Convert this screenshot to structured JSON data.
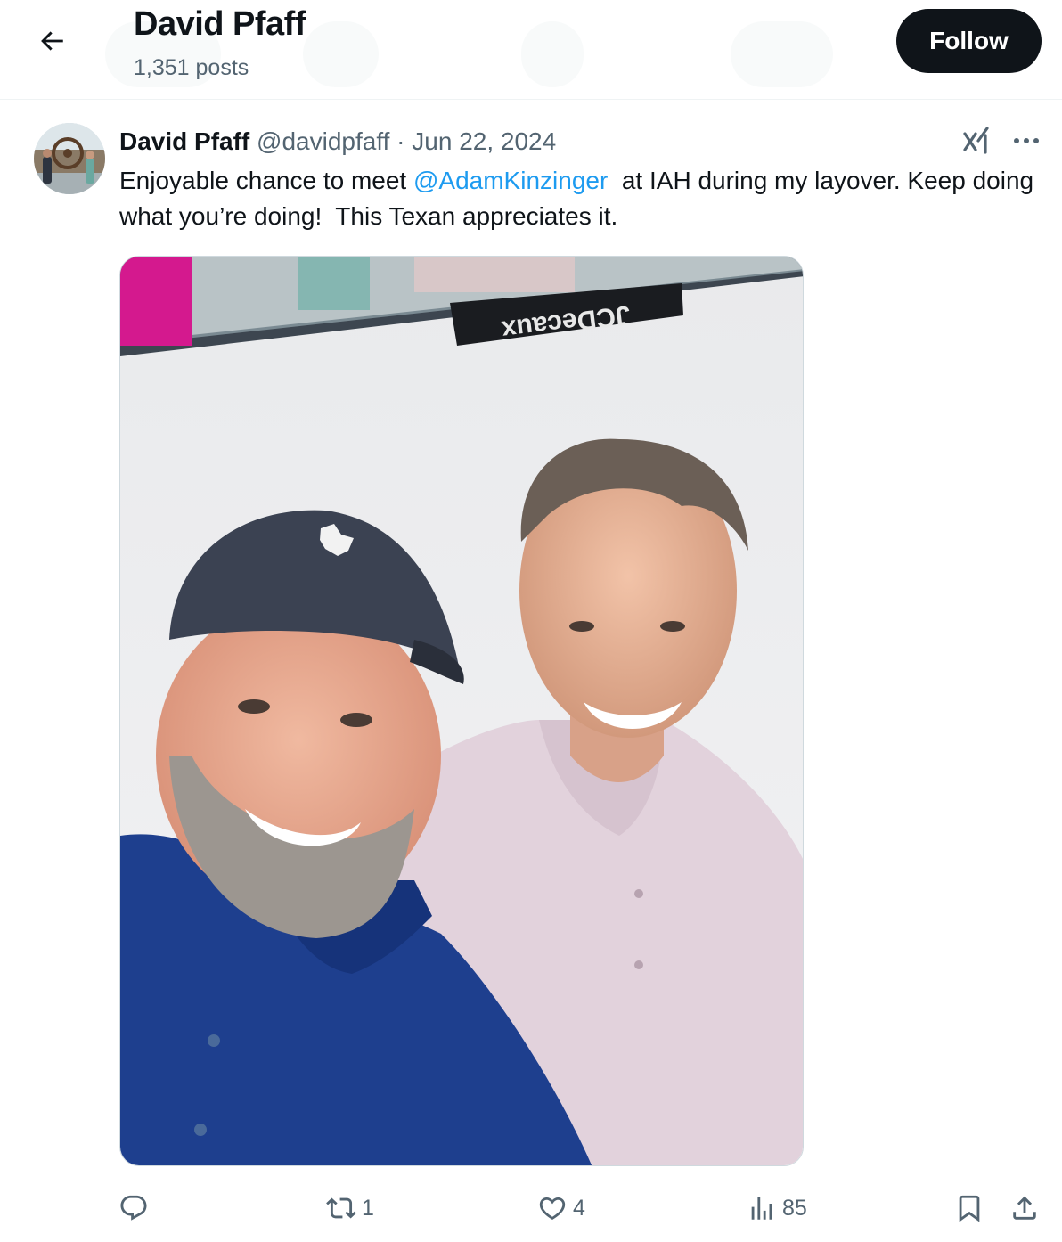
{
  "header": {
    "title": "David Pfaff",
    "posts_count": "1,351 posts",
    "follow_label": "Follow"
  },
  "post": {
    "author_name": "David Pfaff",
    "author_handle": "@davidpfaff",
    "separator": "·",
    "date": "Jun 22, 2024",
    "text_before": "Enjoyable chance to meet ",
    "mention": "@AdamKinzinger",
    "text_after": "  at IAH during my layover. Keep doing what you’re doing!  This Texan appreciates it.",
    "image_sign_text": "JCDecaux"
  },
  "actions": {
    "reply_count": "",
    "repost_count": "1",
    "like_count": "4",
    "views_count": "85"
  },
  "icons": {
    "back": "arrow-left-icon",
    "grok": "grok-icon",
    "more": "more-icon",
    "reply": "reply-icon",
    "repost": "repost-icon",
    "like": "heart-icon",
    "views": "views-icon",
    "bookmark": "bookmark-icon",
    "share": "share-icon"
  },
  "colors": {
    "link": "#1d9bf0",
    "secondary_text": "#536471",
    "primary_text": "#0f1419",
    "follow_bg": "#0f1419"
  }
}
